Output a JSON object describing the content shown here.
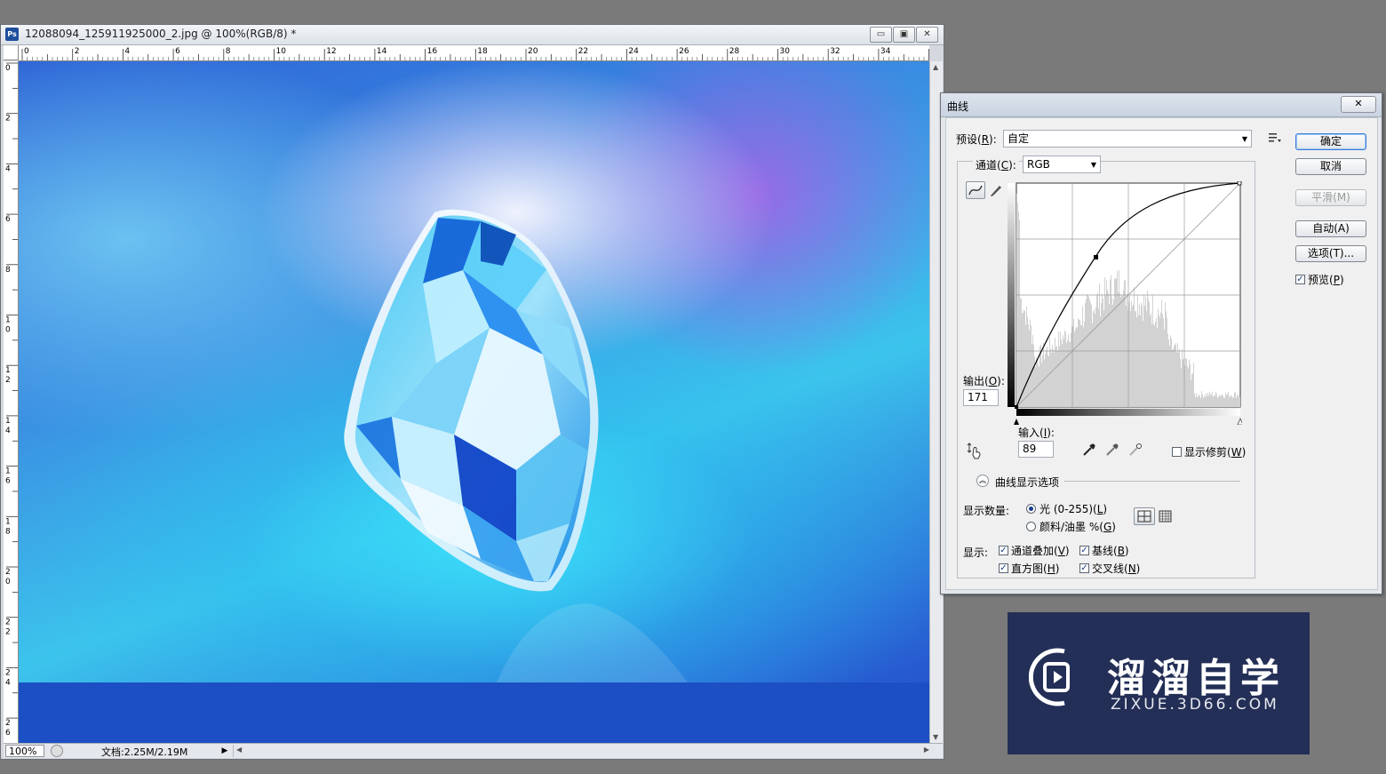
{
  "document": {
    "title": "12088094_125911925000_2.jpg @ 100%(RGB/8) *",
    "app_icon": "Ps",
    "window_buttons": {
      "minimize": "▭",
      "restore": "▣",
      "close": "✕"
    },
    "ruler_h_labels": [
      "0",
      "2",
      "4",
      "6",
      "8",
      "10",
      "12",
      "14",
      "16",
      "18",
      "20",
      "22",
      "24",
      "26",
      "28",
      "30",
      "32",
      "34"
    ],
    "ruler_v_labels": [
      "0",
      "2",
      "4",
      "6",
      "8",
      "10",
      "12",
      "14",
      "16",
      "18",
      "20",
      "22",
      "24",
      "26"
    ],
    "zoom": "100%",
    "doc_info": "文档:2.25M/2.19M"
  },
  "curves_dialog": {
    "title": "曲线",
    "close_label": "✕",
    "preset_label": "预设(",
    "preset_key": "R",
    "preset_label_end": "):",
    "preset_value": "自定",
    "channel_label": "通道(",
    "channel_key": "C",
    "channel_label_end": "):",
    "channel_value": "RGB",
    "output_label": "输出(",
    "output_key": "O",
    "output_label_end": "):",
    "output_value": "171",
    "input_label": "输入(",
    "input_key": "I",
    "input_label_end": "):",
    "input_value": "89",
    "show_clipping_label": "显示修剪(",
    "show_clipping_key": "W",
    "show_clipping_end": ")",
    "display_options_label": "曲线显示选项",
    "show_amount_label": "显示数量:",
    "light_label": "光 (0-255)(",
    "light_key": "L",
    "light_end": ")",
    "pigment_label": "颜料/油墨 %(",
    "pigment_key": "G",
    "pigment_end": ")",
    "show_label": "显示:",
    "channel_overlay_label": "通道叠加(",
    "channel_overlay_key": "V",
    "channel_overlay_end": ")",
    "baseline_label": "基线(",
    "baseline_key": "B",
    "baseline_end": ")",
    "histogram_label": "直方图(",
    "histogram_key": "H",
    "histogram_end": ")",
    "intersection_label": "交叉线(",
    "intersection_key": "N",
    "intersection_end": ")",
    "buttons": {
      "ok": "确定",
      "cancel": "取消",
      "smooth": "平滑(M)",
      "auto": "自动(A)",
      "options": "选项(T)..."
    },
    "preview_label": "预览(",
    "preview_key": "P",
    "preview_end": ")",
    "icons": {
      "preset_menu": "preset-options-icon",
      "curve_tool": "curve-point-icon",
      "pencil_tool": "pencil-icon",
      "target_adjust": "hand-adjust-icon",
      "eyedropper_black": "eyedropper-black-icon",
      "eyedropper_gray": "eyedropper-gray-icon",
      "eyedropper_white": "eyedropper-white-icon",
      "grid_simple": "grid-4x4-icon",
      "grid_detailed": "grid-10x10-icon"
    }
  },
  "watermark": {
    "brand": "溜溜自学",
    "url": "ZIXUE.3D66.COM"
  }
}
